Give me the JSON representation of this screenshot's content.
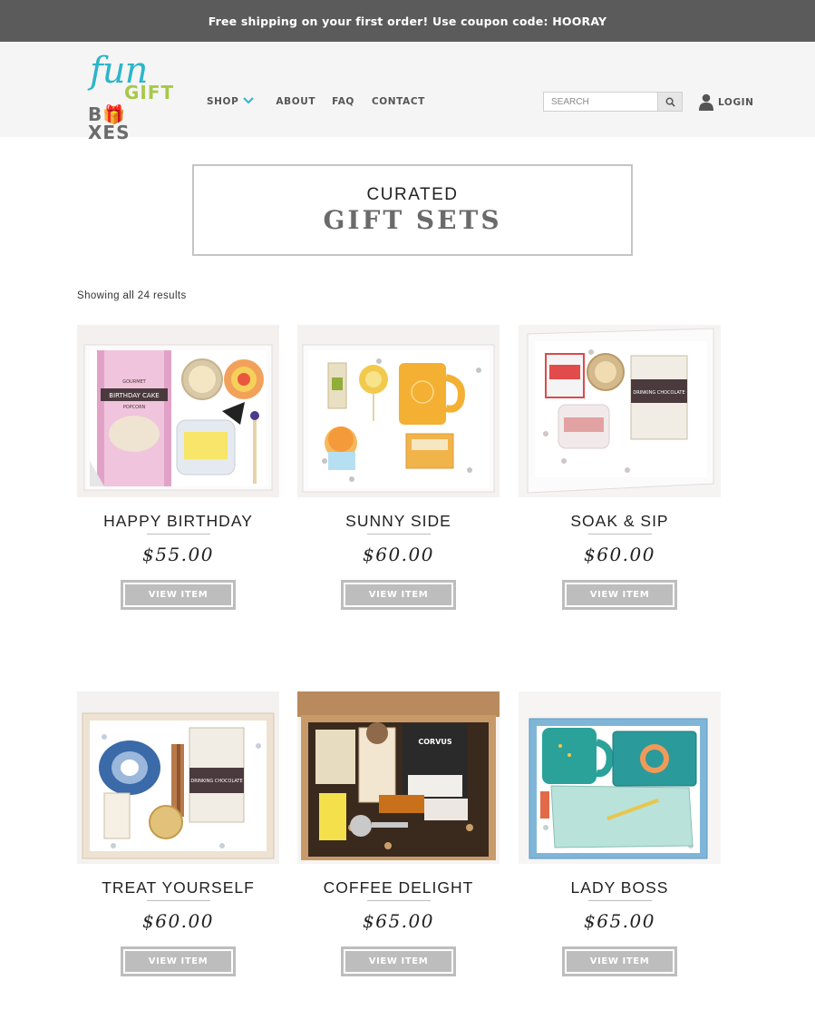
{
  "announcement": "Free shipping on your first order! Use coupon code: HOORAY",
  "logo": {
    "line1": "fun",
    "line2": "GIFT",
    "line3_a": "B",
    "line3_b": "X",
    "line3_c": "ES"
  },
  "nav": {
    "shop": "SHOP",
    "about": "ABOUT",
    "faq": "FAQ",
    "contact": "CONTACT"
  },
  "search": {
    "placeholder": "SEARCH"
  },
  "login": "LOGIN",
  "page_title": {
    "small": "CURATED",
    "big": "GIFT SETS"
  },
  "results_text": "Showing all 24 results",
  "products": [
    {
      "name": "HAPPY BIRTHDAY",
      "price": "$55.00",
      "button": "VIEW ITEM"
    },
    {
      "name": "SUNNY SIDE",
      "price": "$60.00",
      "button": "VIEW ITEM"
    },
    {
      "name": "SOAK & SIP",
      "price": "$60.00",
      "button": "VIEW ITEM"
    },
    {
      "name": "TREAT YOURSELF",
      "price": "$60.00",
      "button": "VIEW ITEM"
    },
    {
      "name": "COFFEE DELIGHT",
      "price": "$65.00",
      "button": "VIEW ITEM"
    },
    {
      "name": "LADY BOSS",
      "price": "$65.00",
      "button": "VIEW ITEM"
    }
  ],
  "image_labels": {
    "p0_bag_top": "GOURMET",
    "p0_bag": "BIRTHDAY CAKE",
    "p0_bag_bottom": "POPCORN",
    "p2_box": "DRINKING CHOCOLATE",
    "p3_box": "DRINKING CHOCOLATE",
    "p4_bag": "CORVUS",
    "colors": {
      "accent": "#2cb6c9",
      "button": "#bdbdbd",
      "topbar": "#5b5b5b"
    }
  }
}
